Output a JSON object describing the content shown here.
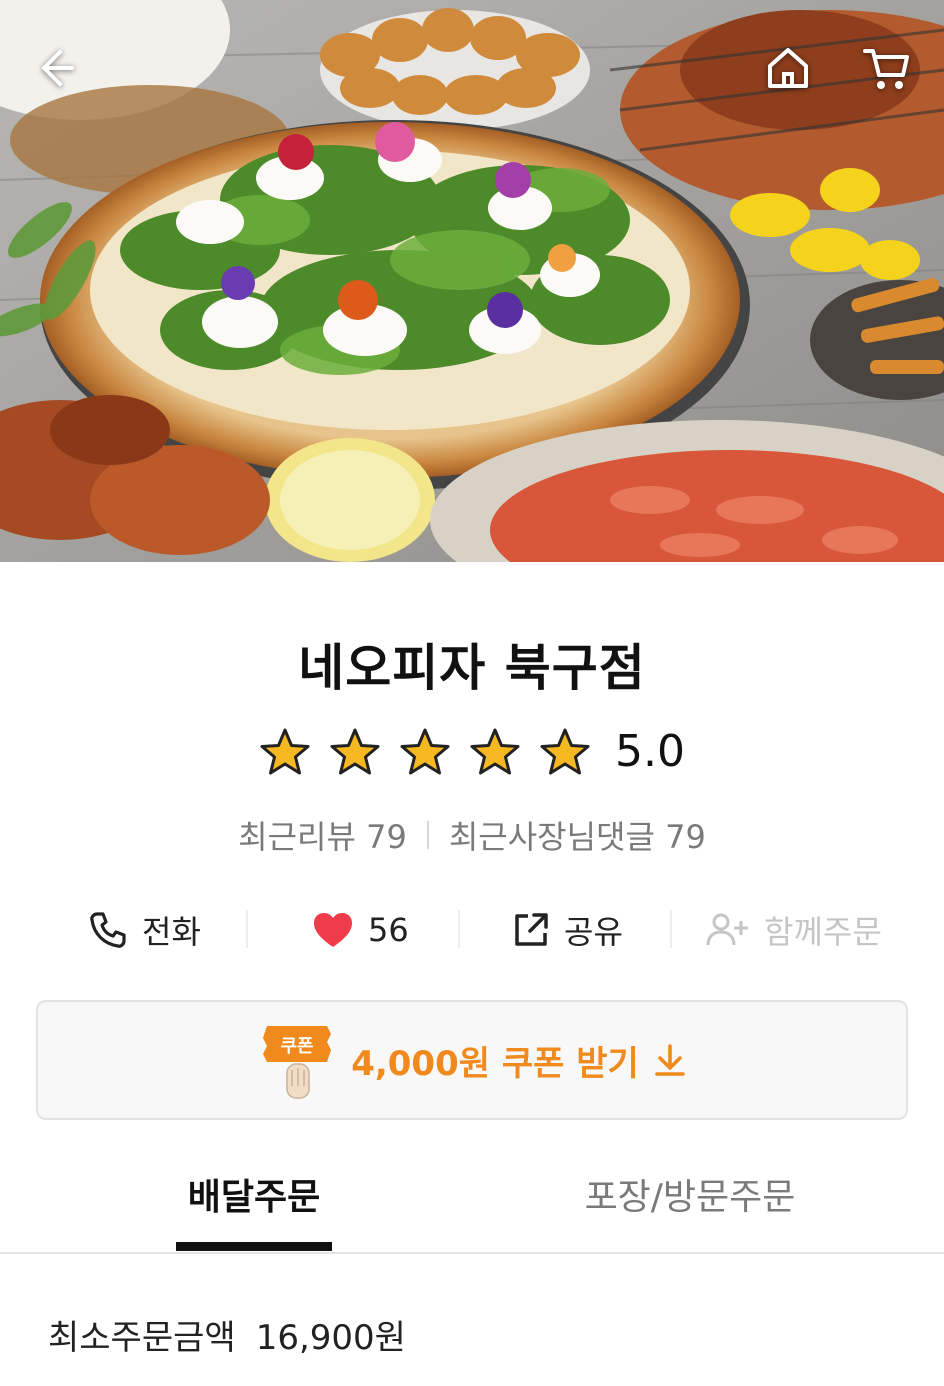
{
  "header": {
    "back_icon": "back-arrow-icon",
    "home_icon": "home-icon",
    "cart_icon": "cart-icon"
  },
  "store": {
    "name": "네오피자 북구점",
    "rating": "5.0",
    "rating_stars": 5,
    "recent_reviews": "최근리뷰 79",
    "recent_owner_replies": "최근사장님댓글 79"
  },
  "actions": {
    "call_label": "전화",
    "like_count": "56",
    "share_label": "공유",
    "group_order_label": "함께주문"
  },
  "coupon": {
    "badge": "쿠폰",
    "text": "4,000원 쿠폰 받기"
  },
  "tabs": {
    "delivery": "배달주문",
    "pickup": "포장/방문주문"
  },
  "min_order": {
    "label": "최소주문금액",
    "value": "16,900원"
  },
  "colors": {
    "accent_orange": "#f08a1c",
    "heart_red": "#ef3b4a",
    "star_gold": "#f5b820"
  }
}
